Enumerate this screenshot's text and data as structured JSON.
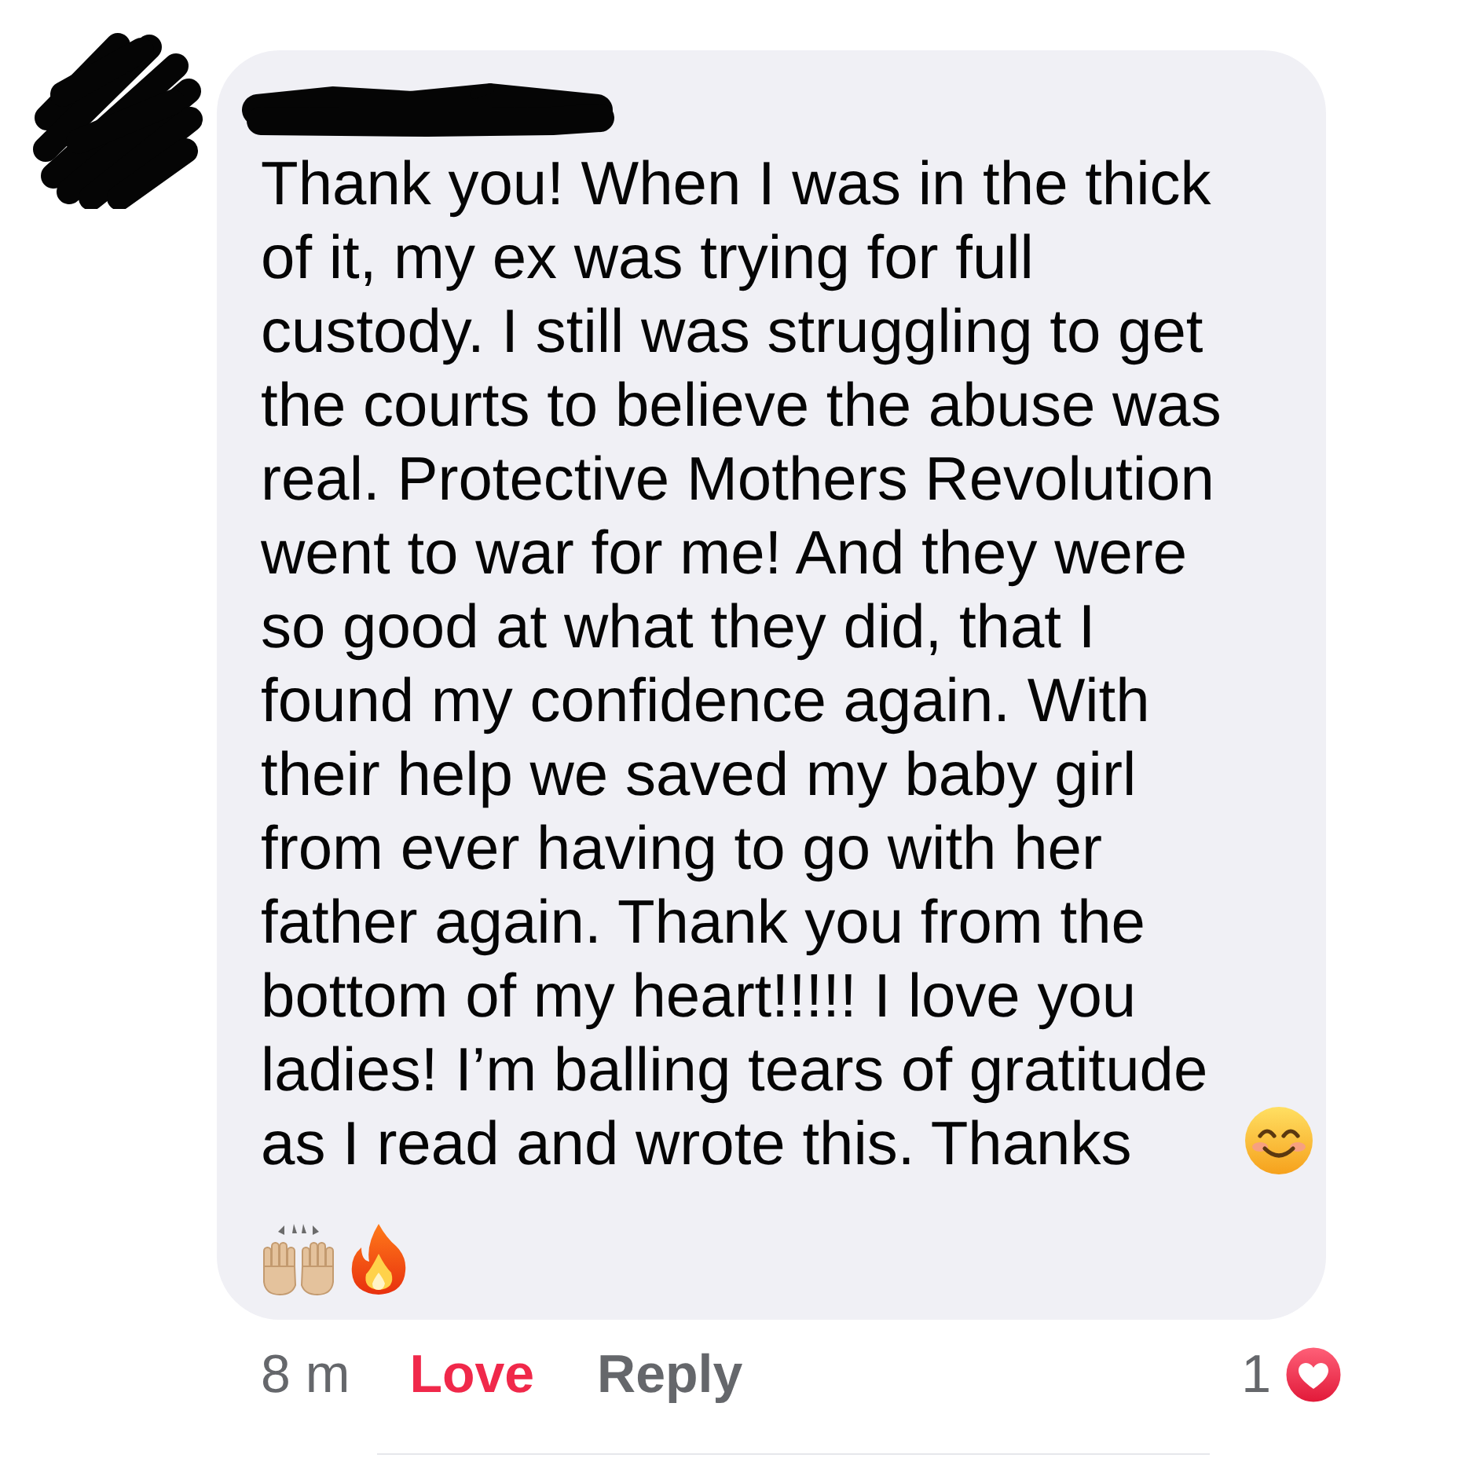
{
  "comment": {
    "author": {
      "redacted": true
    },
    "text": "Thank you! When I was in the thick of it, my ex was trying for full custody. I still was struggling to get the courts to believe the abuse was real. Protective Mothers Revolution went to war for me! And they were so good at what they did, that I found my confidence again. With their help we saved my baby girl from ever having to go with her father again. Thank you from the bottom of my heart!!!!! I love you ladies! I’m balling tears of gratitude as I read and wrote this. Thanks"
  },
  "meta": {
    "time": "8 m",
    "actions": [
      {
        "label": "Love",
        "selected": true
      },
      {
        "label": "Reply",
        "selected": false
      }
    ],
    "reaction_count": "1"
  }
}
